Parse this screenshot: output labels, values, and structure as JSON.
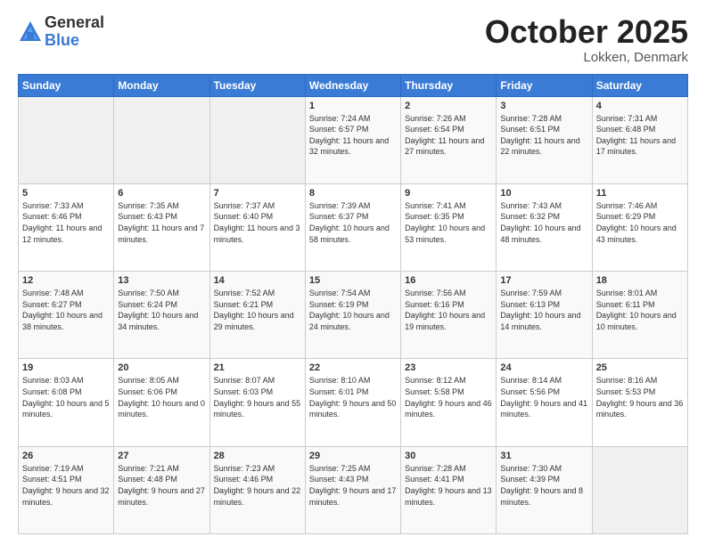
{
  "logo": {
    "general": "General",
    "blue": "Blue"
  },
  "header": {
    "month": "October 2025",
    "location": "Lokken, Denmark"
  },
  "weekdays": [
    "Sunday",
    "Monday",
    "Tuesday",
    "Wednesday",
    "Thursday",
    "Friday",
    "Saturday"
  ],
  "weeks": [
    [
      {
        "day": "",
        "sunrise": "",
        "sunset": "",
        "daylight": ""
      },
      {
        "day": "",
        "sunrise": "",
        "sunset": "",
        "daylight": ""
      },
      {
        "day": "",
        "sunrise": "",
        "sunset": "",
        "daylight": ""
      },
      {
        "day": "1",
        "sunrise": "Sunrise: 7:24 AM",
        "sunset": "Sunset: 6:57 PM",
        "daylight": "Daylight: 11 hours and 32 minutes."
      },
      {
        "day": "2",
        "sunrise": "Sunrise: 7:26 AM",
        "sunset": "Sunset: 6:54 PM",
        "daylight": "Daylight: 11 hours and 27 minutes."
      },
      {
        "day": "3",
        "sunrise": "Sunrise: 7:28 AM",
        "sunset": "Sunset: 6:51 PM",
        "daylight": "Daylight: 11 hours and 22 minutes."
      },
      {
        "day": "4",
        "sunrise": "Sunrise: 7:31 AM",
        "sunset": "Sunset: 6:48 PM",
        "daylight": "Daylight: 11 hours and 17 minutes."
      }
    ],
    [
      {
        "day": "5",
        "sunrise": "Sunrise: 7:33 AM",
        "sunset": "Sunset: 6:46 PM",
        "daylight": "Daylight: 11 hours and 12 minutes."
      },
      {
        "day": "6",
        "sunrise": "Sunrise: 7:35 AM",
        "sunset": "Sunset: 6:43 PM",
        "daylight": "Daylight: 11 hours and 7 minutes."
      },
      {
        "day": "7",
        "sunrise": "Sunrise: 7:37 AM",
        "sunset": "Sunset: 6:40 PM",
        "daylight": "Daylight: 11 hours and 3 minutes."
      },
      {
        "day": "8",
        "sunrise": "Sunrise: 7:39 AM",
        "sunset": "Sunset: 6:37 PM",
        "daylight": "Daylight: 10 hours and 58 minutes."
      },
      {
        "day": "9",
        "sunrise": "Sunrise: 7:41 AM",
        "sunset": "Sunset: 6:35 PM",
        "daylight": "Daylight: 10 hours and 53 minutes."
      },
      {
        "day": "10",
        "sunrise": "Sunrise: 7:43 AM",
        "sunset": "Sunset: 6:32 PM",
        "daylight": "Daylight: 10 hours and 48 minutes."
      },
      {
        "day": "11",
        "sunrise": "Sunrise: 7:46 AM",
        "sunset": "Sunset: 6:29 PM",
        "daylight": "Daylight: 10 hours and 43 minutes."
      }
    ],
    [
      {
        "day": "12",
        "sunrise": "Sunrise: 7:48 AM",
        "sunset": "Sunset: 6:27 PM",
        "daylight": "Daylight: 10 hours and 38 minutes."
      },
      {
        "day": "13",
        "sunrise": "Sunrise: 7:50 AM",
        "sunset": "Sunset: 6:24 PM",
        "daylight": "Daylight: 10 hours and 34 minutes."
      },
      {
        "day": "14",
        "sunrise": "Sunrise: 7:52 AM",
        "sunset": "Sunset: 6:21 PM",
        "daylight": "Daylight: 10 hours and 29 minutes."
      },
      {
        "day": "15",
        "sunrise": "Sunrise: 7:54 AM",
        "sunset": "Sunset: 6:19 PM",
        "daylight": "Daylight: 10 hours and 24 minutes."
      },
      {
        "day": "16",
        "sunrise": "Sunrise: 7:56 AM",
        "sunset": "Sunset: 6:16 PM",
        "daylight": "Daylight: 10 hours and 19 minutes."
      },
      {
        "day": "17",
        "sunrise": "Sunrise: 7:59 AM",
        "sunset": "Sunset: 6:13 PM",
        "daylight": "Daylight: 10 hours and 14 minutes."
      },
      {
        "day": "18",
        "sunrise": "Sunrise: 8:01 AM",
        "sunset": "Sunset: 6:11 PM",
        "daylight": "Daylight: 10 hours and 10 minutes."
      }
    ],
    [
      {
        "day": "19",
        "sunrise": "Sunrise: 8:03 AM",
        "sunset": "Sunset: 6:08 PM",
        "daylight": "Daylight: 10 hours and 5 minutes."
      },
      {
        "day": "20",
        "sunrise": "Sunrise: 8:05 AM",
        "sunset": "Sunset: 6:06 PM",
        "daylight": "Daylight: 10 hours and 0 minutes."
      },
      {
        "day": "21",
        "sunrise": "Sunrise: 8:07 AM",
        "sunset": "Sunset: 6:03 PM",
        "daylight": "Daylight: 9 hours and 55 minutes."
      },
      {
        "day": "22",
        "sunrise": "Sunrise: 8:10 AM",
        "sunset": "Sunset: 6:01 PM",
        "daylight": "Daylight: 9 hours and 50 minutes."
      },
      {
        "day": "23",
        "sunrise": "Sunrise: 8:12 AM",
        "sunset": "Sunset: 5:58 PM",
        "daylight": "Daylight: 9 hours and 46 minutes."
      },
      {
        "day": "24",
        "sunrise": "Sunrise: 8:14 AM",
        "sunset": "Sunset: 5:56 PM",
        "daylight": "Daylight: 9 hours and 41 minutes."
      },
      {
        "day": "25",
        "sunrise": "Sunrise: 8:16 AM",
        "sunset": "Sunset: 5:53 PM",
        "daylight": "Daylight: 9 hours and 36 minutes."
      }
    ],
    [
      {
        "day": "26",
        "sunrise": "Sunrise: 7:19 AM",
        "sunset": "Sunset: 4:51 PM",
        "daylight": "Daylight: 9 hours and 32 minutes."
      },
      {
        "day": "27",
        "sunrise": "Sunrise: 7:21 AM",
        "sunset": "Sunset: 4:48 PM",
        "daylight": "Daylight: 9 hours and 27 minutes."
      },
      {
        "day": "28",
        "sunrise": "Sunrise: 7:23 AM",
        "sunset": "Sunset: 4:46 PM",
        "daylight": "Daylight: 9 hours and 22 minutes."
      },
      {
        "day": "29",
        "sunrise": "Sunrise: 7:25 AM",
        "sunset": "Sunset: 4:43 PM",
        "daylight": "Daylight: 9 hours and 17 minutes."
      },
      {
        "day": "30",
        "sunrise": "Sunrise: 7:28 AM",
        "sunset": "Sunset: 4:41 PM",
        "daylight": "Daylight: 9 hours and 13 minutes."
      },
      {
        "day": "31",
        "sunrise": "Sunrise: 7:30 AM",
        "sunset": "Sunset: 4:39 PM",
        "daylight": "Daylight: 9 hours and 8 minutes."
      },
      {
        "day": "",
        "sunrise": "",
        "sunset": "",
        "daylight": ""
      }
    ]
  ]
}
